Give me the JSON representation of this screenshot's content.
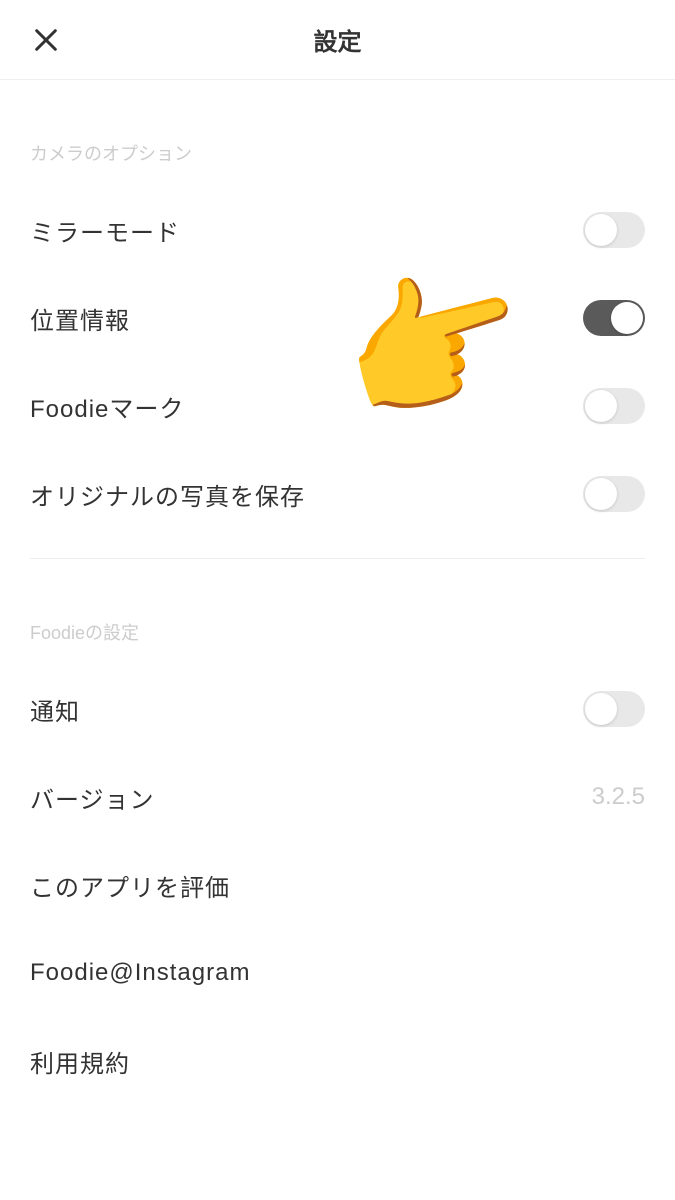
{
  "header": {
    "title": "設定"
  },
  "sections": {
    "camera": {
      "title": "カメラのオプション",
      "rows": {
        "mirror": {
          "label": "ミラーモード",
          "on": false
        },
        "location": {
          "label": "位置情報",
          "on": true
        },
        "foodiemark": {
          "label": "Foodieマーク",
          "on": false
        },
        "saveoriginal": {
          "label": "オリジナルの写真を保存",
          "on": false
        }
      }
    },
    "foodie": {
      "title": "Foodieの設定",
      "rows": {
        "notifications": {
          "label": "通知",
          "on": false
        },
        "version": {
          "label": "バージョン",
          "value": "3.2.5"
        },
        "rate": {
          "label": "このアプリを評価"
        },
        "instagram": {
          "label": "Foodie@Instagram"
        },
        "terms": {
          "label": "利用規約"
        }
      }
    }
  },
  "overlay": {
    "hand_emoji": "👉"
  }
}
